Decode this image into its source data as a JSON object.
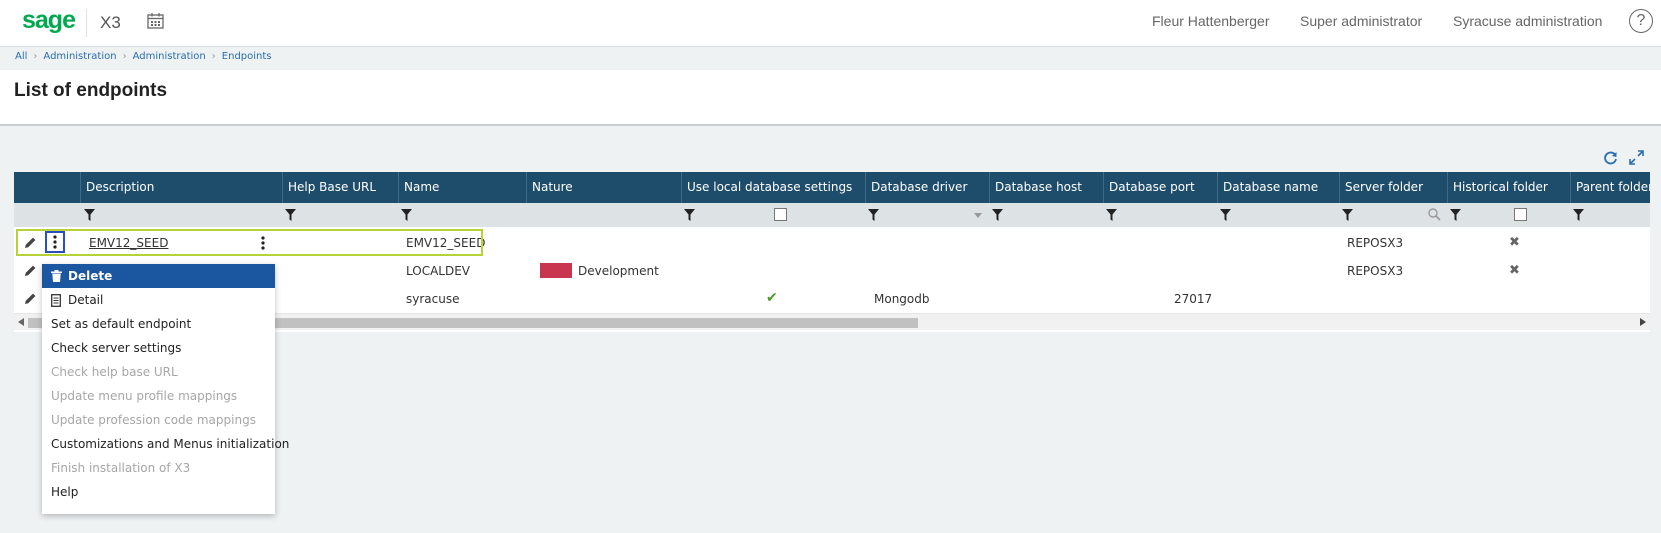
{
  "header": {
    "logo": "sage",
    "product": "X3",
    "user": "Fleur Hattenberger",
    "role": "Super administrator",
    "workspace": "Syracuse administration",
    "help": "?"
  },
  "breadcrumb": [
    "All",
    "Administration",
    "Administration",
    "Endpoints"
  ],
  "page": {
    "title": "List of endpoints"
  },
  "table": {
    "columns": [
      "Description",
      "Help Base URL",
      "Name",
      "Nature",
      "Use local database settings",
      "Database driver",
      "Database host",
      "Database port",
      "Database name",
      "Server folder",
      "Historical folder",
      "Parent folder"
    ],
    "rows": [
      {
        "description": "EMV12_SEED",
        "name": "EMV12_SEED",
        "nature": "",
        "use_local_db": "",
        "driver": "",
        "port": "",
        "server_folder": "REPOSX3",
        "historical": "✖"
      },
      {
        "description": "",
        "name": "LOCALDEV",
        "nature": "Development",
        "use_local_db": "",
        "driver": "",
        "port": "",
        "server_folder": "REPOSX3",
        "historical": "✖"
      },
      {
        "description": "",
        "name": "syracuse",
        "nature": "",
        "use_local_db": "✔",
        "driver": "Mongodb",
        "port": "27017",
        "server_folder": "",
        "historical": ""
      }
    ]
  },
  "context_menu": {
    "items": [
      {
        "label": "Delete",
        "state": "active",
        "icon": "trash-icon"
      },
      {
        "label": "Detail",
        "state": "normal",
        "icon": "document-icon"
      },
      {
        "label": "Set as default endpoint",
        "state": "normal"
      },
      {
        "label": "Check server settings",
        "state": "normal"
      },
      {
        "label": "Check help base URL",
        "state": "disabled"
      },
      {
        "label": "Update menu profile mappings",
        "state": "disabled"
      },
      {
        "label": "Update profession code mappings",
        "state": "disabled"
      },
      {
        "label": "Customizations and Menus initialization",
        "state": "normal"
      },
      {
        "label": "Finish installation of X3",
        "state": "disabled"
      },
      {
        "label": "Help",
        "state": "normal"
      }
    ]
  },
  "colors": {
    "brand": "#00a94f",
    "header_bg": "#1e4d6b",
    "menu_active": "#1b56a0",
    "nature_development": "#c8374f",
    "row_outline": "#b5d334"
  }
}
